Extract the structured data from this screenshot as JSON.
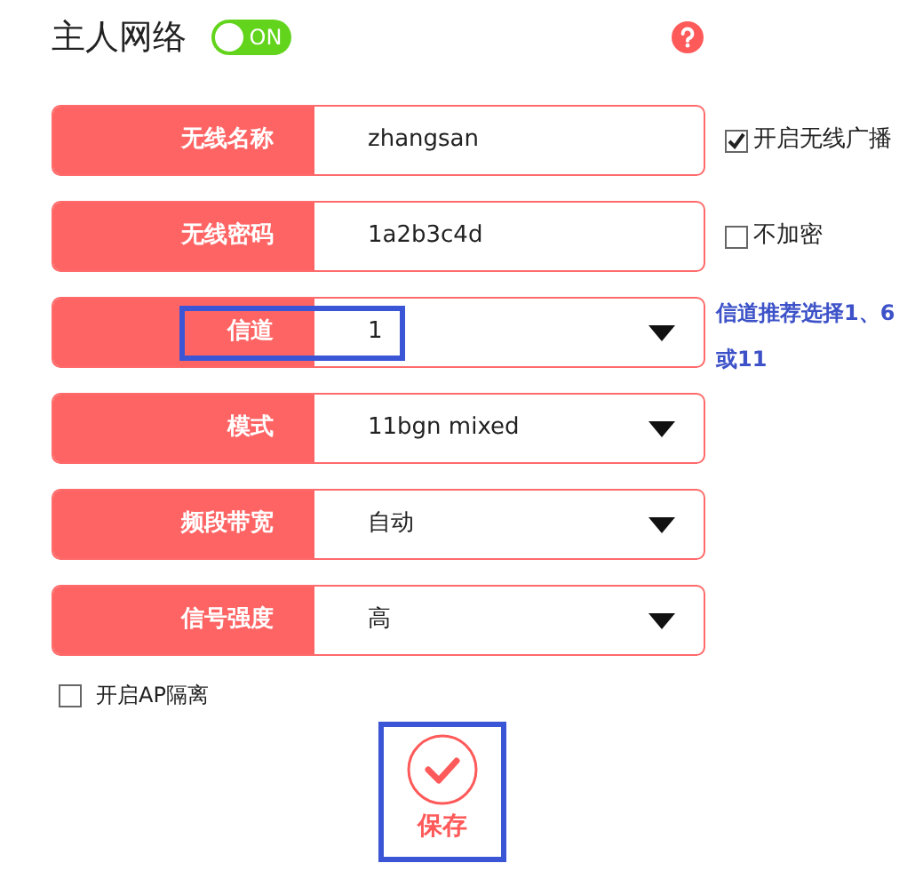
{
  "header": {
    "title": "主人网络",
    "toggle": {
      "label": "ON",
      "on": true
    }
  },
  "fields": [
    {
      "kind": "text",
      "label": "无线名称",
      "value": "zhangsan",
      "option": {
        "label": "开启无线广播",
        "checked": true
      }
    },
    {
      "kind": "text",
      "label": "无线密码",
      "value": "1a2b3c4d",
      "option": {
        "label": "不加密",
        "checked": false
      }
    },
    {
      "kind": "select",
      "label": "信道",
      "value": "1",
      "highlighted": true,
      "note": "信道推荐选择1、6或11"
    },
    {
      "kind": "select",
      "label": "模式",
      "value": "11bgn mixed"
    },
    {
      "kind": "select",
      "label": "频段带宽",
      "value": "自动"
    },
    {
      "kind": "select",
      "label": "信号强度",
      "value": "高"
    }
  ],
  "ap_isolation": {
    "label": "开启AP隔离",
    "checked": false
  },
  "save": {
    "label": "保存",
    "highlighted": true
  }
}
